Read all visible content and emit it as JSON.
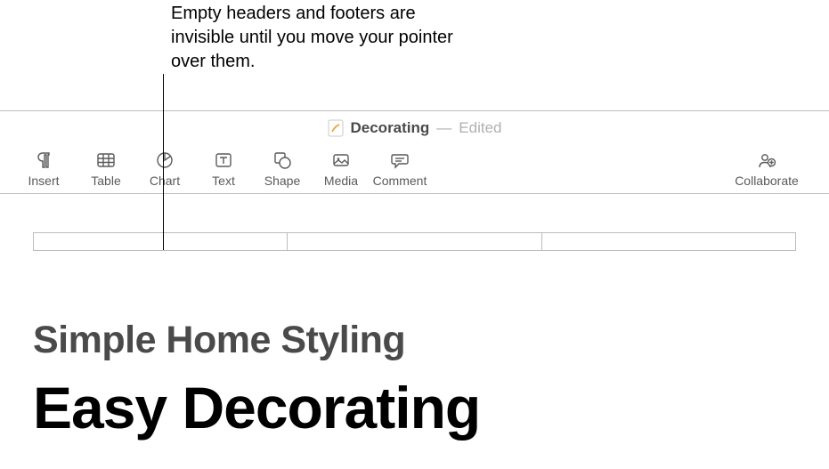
{
  "callout": {
    "text": "Empty headers and footers are invisible until you move your pointer over them."
  },
  "titlebar": {
    "name": "Decorating",
    "dash": "—",
    "status": "Edited"
  },
  "toolbar": {
    "insert": "Insert",
    "table": "Table",
    "chart": "Chart",
    "text": "Text",
    "shape": "Shape",
    "media": "Media",
    "comment": "Comment",
    "collaborate": "Collaborate"
  },
  "document": {
    "subtitle": "Simple Home Styling",
    "title": "Easy Decorating"
  }
}
